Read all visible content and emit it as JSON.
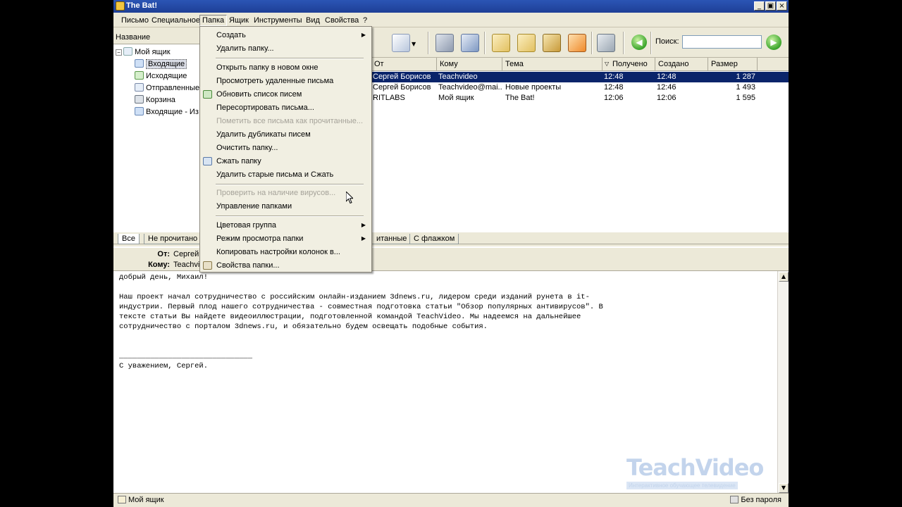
{
  "window": {
    "title": "The Bat!",
    "min_glyph": "_",
    "max_glyph": "▣",
    "close_glyph": "×"
  },
  "menubar": [
    "Письмо",
    "Специальное",
    "Папка",
    "Ящик",
    "Инструменты",
    "Вид",
    "Свойства",
    "?"
  ],
  "toolbar": {
    "search_label": "Поиск:",
    "search_value": "",
    "back_glyph": "◀",
    "forward_glyph": "▶"
  },
  "tree": {
    "header": "Название",
    "root": "Мой ящик",
    "items": [
      "Входящие",
      "Исходящие",
      "Отправленные",
      "Корзина",
      "Входящие - Из"
    ]
  },
  "list": {
    "columns": [
      "От",
      "Кому",
      "Тема",
      "Получено",
      "Создано",
      "Размер"
    ],
    "rows": [
      {
        "from": "Сергей Борисов",
        "to": "Teachvideo",
        "subject": "",
        "received": "12:48",
        "created": "12:48",
        "size": "1 287"
      },
      {
        "from": "Сергей Борисов",
        "to": "Teachvideo@mai...",
        "subject": "Новые проекты",
        "received": "12:48",
        "created": "12:46",
        "size": "1 493"
      },
      {
        "from": "RITLABS",
        "to": "Мой ящик",
        "subject": "The Bat!",
        "received": "12:06",
        "created": "12:06",
        "size": "1 595"
      }
    ]
  },
  "tabs": [
    "Все",
    "Не прочитано",
    "итанные",
    "С флажком"
  ],
  "preview": {
    "from_label": "От:",
    "from_value": "Сергей",
    "to_label": "Кому:",
    "to_value": "Teachvi"
  },
  "body": {
    "greeting": "добрый день, Михаил!",
    "paragraph": "Наш проект начал сотрудничество с российским онлайн-изданием 3dnews.ru, лидером среди изданий рунета в it-\nиндустрии. Первый плод нашего сотрудничества - совместная подготовка статьи \"Обзор популярных антивирусов\". В\nтексте статьи Вы найдете видеоиллюстрации, подготовленной командой TeachVideo. Мы надеемся на дальнейшее\nсотрудничество с порталом 3dnews.ru, и обязательно будем освещать подобные события.",
    "signature_line": "______________________________",
    "signature": "С уважением, Сергей."
  },
  "watermark": {
    "title": "TeachVideo",
    "subtitle": "Интерактивное обучающее телевидение"
  },
  "status": {
    "left": "Мой ящик",
    "right": "Без пароля"
  },
  "dropdown": {
    "items": [
      {
        "label": "Создать",
        "submenu": true,
        "disabled": false
      },
      {
        "label": "Удалить папку...",
        "disabled": false
      },
      {
        "label": "Открыть папку в новом окне",
        "disabled": false
      },
      {
        "label": "Просмотреть удаленные письма",
        "disabled": false
      },
      {
        "label": "Обновить список писем",
        "disabled": false,
        "icon": "refresh-icon"
      },
      {
        "label": "Пересортировать письма...",
        "disabled": false
      },
      {
        "label": "Пометить все письма как прочитанные...",
        "disabled": true
      },
      {
        "label": "Удалить дубликаты писем",
        "disabled": false
      },
      {
        "label": "Очистить папку...",
        "disabled": false
      },
      {
        "label": "Сжать папку",
        "disabled": false,
        "icon": "compress-icon"
      },
      {
        "label": "Удалить старые письма и Сжать",
        "disabled": false
      },
      {
        "label": "Проверить на наличие вирусов...",
        "disabled": true
      },
      {
        "label": "Управление папками",
        "disabled": false
      },
      {
        "label": "Цветовая группа",
        "submenu": true,
        "disabled": false
      },
      {
        "label": "Режим просмотра папки",
        "submenu": true,
        "disabled": false
      },
      {
        "label": "Копировать настройки колонок в...",
        "disabled": false
      },
      {
        "label": "Свойства папки...",
        "disabled": false,
        "icon": "folder-properties-icon"
      }
    ],
    "submenu_glyph": "▶"
  },
  "colors": {
    "title_bar": "#1e3f96",
    "selected_row": "#0a246a",
    "menu_bg": "#f1efe2",
    "disabled_text": "#a6a39a"
  }
}
